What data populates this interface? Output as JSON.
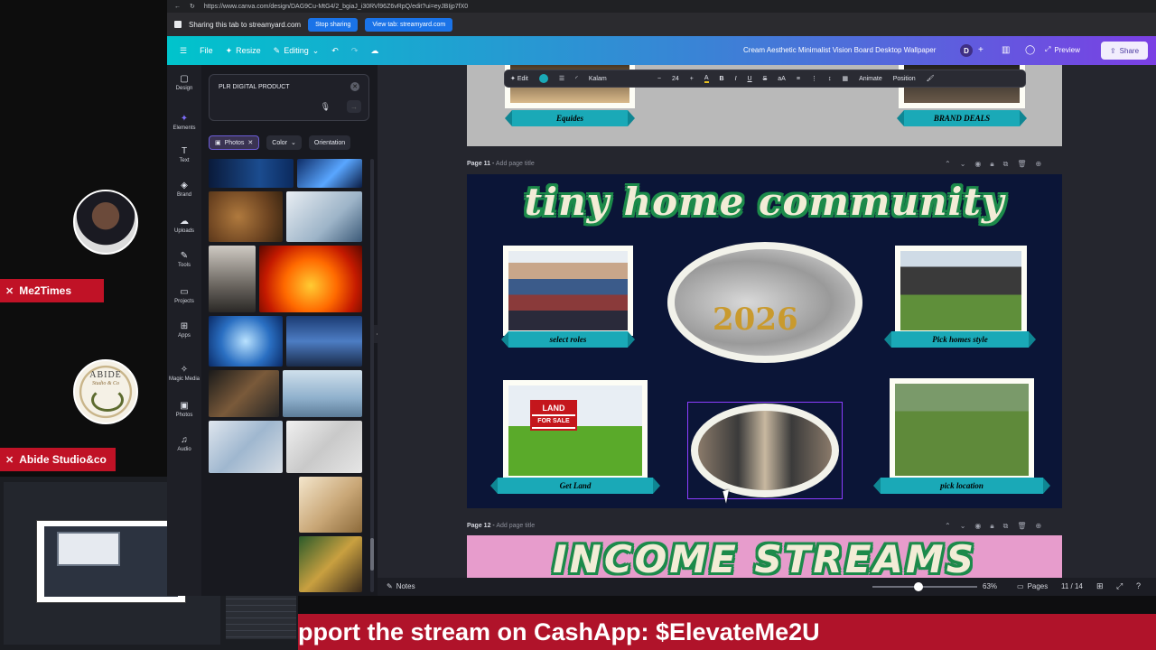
{
  "browser": {
    "url": "https://www.canva.com/design/DAG9Cu-MtG4/2_bgiaJ_i30RVl96Z6vRpQ/edit?ui=eyJBIjp7fX0"
  },
  "share_bar": {
    "message": "Sharing this tab to streamyard.com",
    "stop_label": "Stop sharing",
    "view_label": "View tab: streamyard.com"
  },
  "canva_top": {
    "file": "File",
    "resize": "Resize",
    "editing": "Editing",
    "document_title": "Cream Aesthetic Minimalist Vision Board Desktop Wallpaper",
    "user_initial": "D",
    "preview": "Preview",
    "share": "Share"
  },
  "rail": [
    {
      "label": "Design",
      "icon": "design-icon",
      "glyph": "▢"
    },
    {
      "label": "Elements",
      "icon": "elements-icon",
      "glyph": "✦"
    },
    {
      "label": "Text",
      "icon": "text-icon",
      "glyph": "T"
    },
    {
      "label": "Brand",
      "icon": "brand-icon",
      "glyph": "◈"
    },
    {
      "label": "Uploads",
      "icon": "uploads-icon",
      "glyph": "☁"
    },
    {
      "label": "Tools",
      "icon": "tools-icon",
      "glyph": "✎"
    },
    {
      "label": "Projects",
      "icon": "projects-icon",
      "glyph": "▭"
    },
    {
      "label": "Apps",
      "icon": "apps-icon",
      "glyph": "⊞"
    },
    {
      "label": "Magic Media",
      "icon": "magic-media-icon",
      "glyph": "✧"
    },
    {
      "label": "Photos",
      "icon": "photos-icon",
      "glyph": "▣"
    },
    {
      "label": "Audio",
      "icon": "audio-icon",
      "glyph": "♫"
    }
  ],
  "search": {
    "query": "PLR DIGITAL PRODUCT"
  },
  "filters": {
    "photos": "Photos",
    "color": "Color",
    "orientation": "Orientation"
  },
  "text_toolbar": {
    "edit": "Edit",
    "font": "Kalam",
    "size": "24",
    "bold": "B",
    "italic": "I",
    "underline": "U",
    "strike": "S",
    "case": "aA",
    "animate": "Animate",
    "position": "Position"
  },
  "page10": {
    "left_caption": "Equides",
    "right_caption": "BRAND DEALS"
  },
  "page11": {
    "label": "Page 11",
    "add_title": "Add page title",
    "title": "tiny home community",
    "captions": [
      "select roles",
      "Pick homes style",
      "Get Land",
      "pick location"
    ],
    "center_text": "2026",
    "land_sign_1": "LAND",
    "land_sign_2": "FOR SALE"
  },
  "page12": {
    "label": "Page 12",
    "add_title": "Add page title",
    "title": "INCOME STREAMS"
  },
  "bottom": {
    "notes": "Notes",
    "zoom": "63%",
    "pages": "Pages",
    "page_count": "11 / 14"
  },
  "stream": {
    "guest1": "Me2Times",
    "guest2": "Abide Studio&co",
    "guest2_logo": "ABIDE",
    "guest2_logo_sub": "Studio & Co",
    "banner": "pport the stream on CashApp: $ElevateMe2U"
  },
  "colors": {
    "accent": "#8b3dff",
    "ribbon": "#1aa9b7",
    "page11_bg": "#0b1537",
    "page12_bg": "#e79ccc",
    "banner": "#b0132a"
  }
}
